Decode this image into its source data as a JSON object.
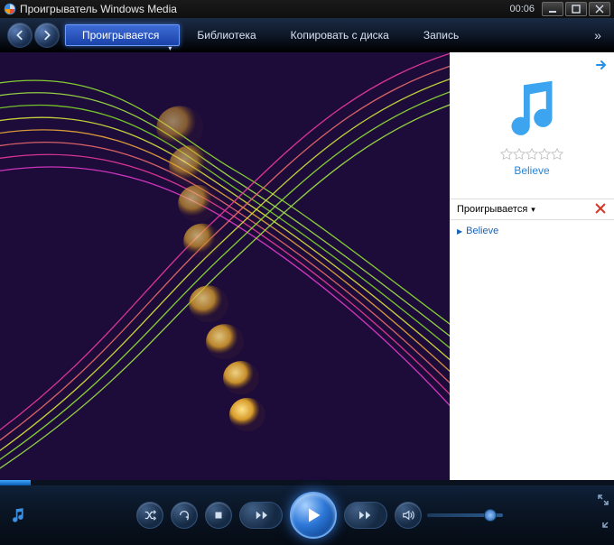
{
  "title": "Проигрыватель Windows Media",
  "clock": "00:06",
  "tabs": {
    "now_playing": "Проигрывается",
    "library": "Библиотека",
    "rip": "Копировать с диска",
    "burn": "Запись"
  },
  "sidebar": {
    "album_title": "Believe",
    "rating": 0,
    "list_label": "Проигрывается",
    "items": [
      {
        "title": "Believe"
      }
    ]
  },
  "playback": {
    "position_fraction": 0.05,
    "volume_fraction": 0.75
  },
  "colors": {
    "accent": "#2d78d8",
    "tab_active": "#2d55c2",
    "link": "#1a63b5"
  }
}
